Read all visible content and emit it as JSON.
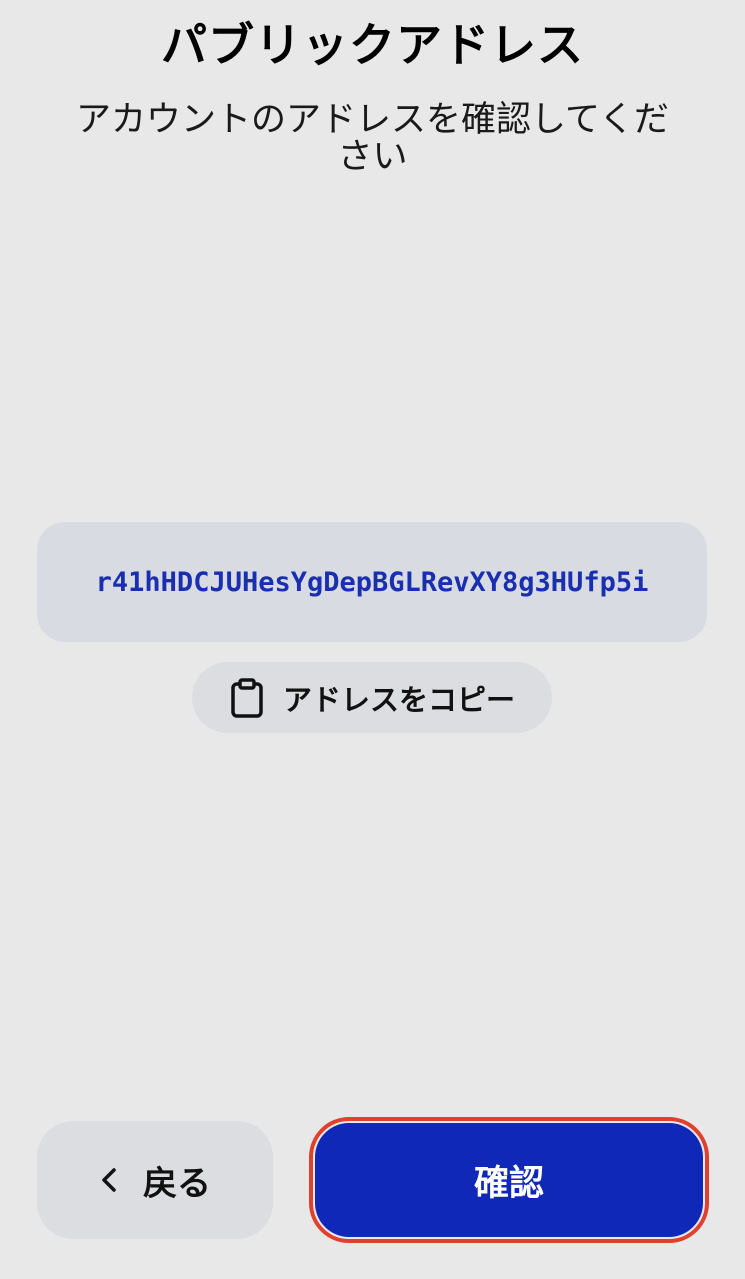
{
  "header": {
    "title": "パブリックアドレス",
    "subtitle": "アカウントのアドレスを確認してください"
  },
  "address": {
    "value": "r41hHDCJUHesYgDepBGLRevXY8g3HUfp5i"
  },
  "copy_button": {
    "icon": "clipboard-icon",
    "label": "アドレスをコピー"
  },
  "footer": {
    "back_icon": "chevron-left-icon",
    "back_label": "戻る",
    "confirm_label": "確認"
  },
  "colors": {
    "background": "#e8e8e8",
    "address_box": "#d8dbe2",
    "address_text": "#1a2fb0",
    "secondary_button": "#dcdde0",
    "primary_button": "#0f28b8",
    "focus_outline": "#e0412f"
  }
}
